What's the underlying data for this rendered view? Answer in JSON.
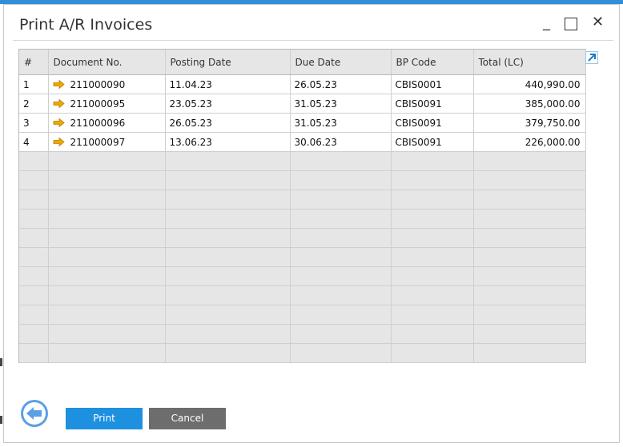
{
  "window": {
    "title": "Print A/R Invoices",
    "controls": {
      "minimize": "_",
      "maximize": "",
      "close": "✕"
    }
  },
  "grid": {
    "columns": [
      "#",
      "Document No.",
      "Posting Date",
      "Due Date",
      "BP Code",
      "Total (LC)"
    ],
    "rows": [
      {
        "num": "1",
        "doc": "211000090",
        "posting": "11.04.23",
        "due": "26.05.23",
        "bp": "CBIS0001",
        "total": "440,990.00"
      },
      {
        "num": "2",
        "doc": "211000095",
        "posting": "23.05.23",
        "due": "31.05.23",
        "bp": "CBIS0091",
        "total": "385,000.00"
      },
      {
        "num": "3",
        "doc": "211000096",
        "posting": "26.05.23",
        "due": "31.05.23",
        "bp": "CBIS0091",
        "total": "379,750.00"
      },
      {
        "num": "4",
        "doc": "211000097",
        "posting": "13.06.23",
        "due": "30.06.23",
        "bp": "CBIS0091",
        "total": "226,000.00"
      }
    ],
    "empty_rows": 11
  },
  "buttons": {
    "print": "Print",
    "cancel": "Cancel"
  },
  "colors": {
    "accent": "#1e90e0",
    "arrow": "#f0a800",
    "cancel": "#6d6d6d"
  }
}
